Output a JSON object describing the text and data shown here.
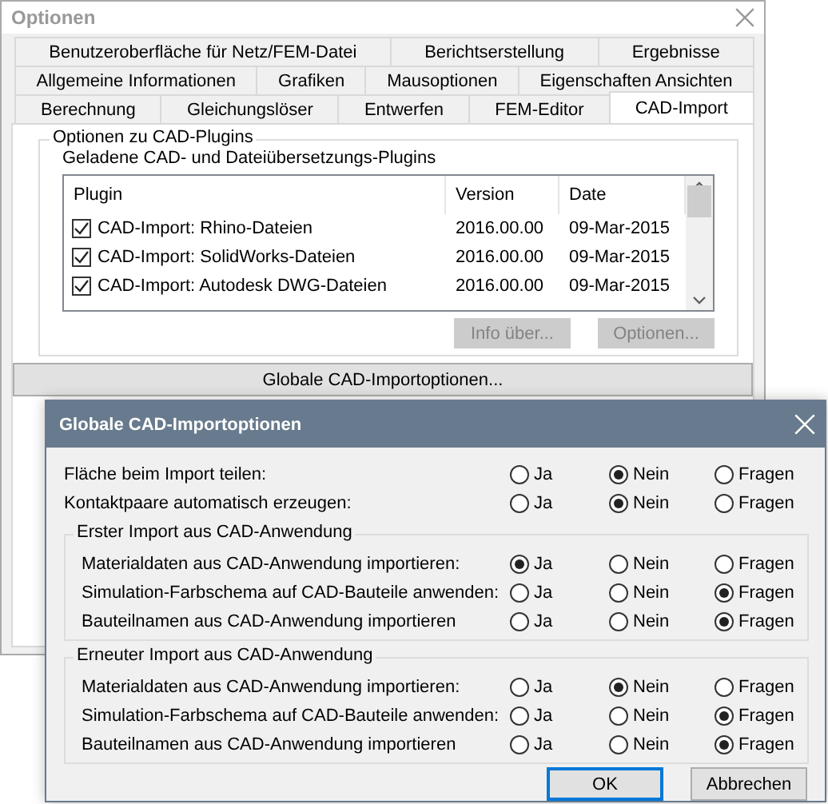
{
  "window": {
    "title": "Optionen"
  },
  "tab_rows": [
    [
      {
        "label": "Benutzeroberfläche für Netz/FEM-Datei",
        "selected": false
      },
      {
        "label": "Berichtserstellung",
        "selected": false
      },
      {
        "label": "Ergebnisse",
        "selected": false
      }
    ],
    [
      {
        "label": "Allgemeine Informationen",
        "selected": false
      },
      {
        "label": "Grafiken",
        "selected": false
      },
      {
        "label": "Mausoptionen",
        "selected": false
      },
      {
        "label": "Eigenschaften Ansichten",
        "selected": false
      }
    ],
    [
      {
        "label": "Berechnung",
        "selected": false
      },
      {
        "label": "Gleichungslöser",
        "selected": false
      },
      {
        "label": "Entwerfen",
        "selected": false
      },
      {
        "label": "FEM-Editor",
        "selected": false
      },
      {
        "label": "CAD-Import",
        "selected": true
      }
    ]
  ],
  "plugins_group": {
    "title": "Optionen zu CAD-Plugins",
    "subtitle": "Geladene CAD- und Dateiübersetzungs-Plugins",
    "columns": [
      "Plugin",
      "Version",
      "Date"
    ],
    "rows": [
      {
        "checked": true,
        "plugin": "CAD-Import:  Rhino-Dateien",
        "version": "2016.00.00",
        "date": "09-Mar-2015"
      },
      {
        "checked": true,
        "plugin": "CAD-Import:  SolidWorks-Dateien",
        "version": "2016.00.00",
        "date": "09-Mar-2015"
      },
      {
        "checked": true,
        "plugin": "CAD-Import: Autodesk DWG-Dateien",
        "version": "2016.00.00",
        "date": "09-Mar-2015"
      }
    ],
    "buttons": [
      {
        "label": "Info über...",
        "disabled": true
      },
      {
        "label": "Optionen...",
        "disabled": true
      }
    ]
  },
  "global_button": {
    "label": "Globale CAD-Importoptionen..."
  },
  "dialog": {
    "title": "Globale CAD-Importoptionen",
    "options": [
      {
        "label": "Fläche beim Import teilen:",
        "choices": [
          {
            "label": "Ja",
            "selected": false
          },
          {
            "label": "Nein",
            "selected": true
          },
          {
            "label": "Fragen",
            "selected": false
          }
        ]
      },
      {
        "label": "Kontaktpaare automatisch erzeugen:",
        "choices": [
          {
            "label": "Ja",
            "selected": false
          },
          {
            "label": "Nein",
            "selected": true
          },
          {
            "label": "Fragen",
            "selected": false
          }
        ]
      }
    ],
    "groups": [
      {
        "title": "Erster Import aus CAD-Anwendung",
        "options": [
          {
            "label": "Materialdaten aus CAD-Anwendung importieren:",
            "choices": [
              {
                "label": "Ja",
                "selected": true
              },
              {
                "label": "Nein",
                "selected": false
              },
              {
                "label": "Fragen",
                "selected": false
              }
            ]
          },
          {
            "label": "Simulation-Farbschema auf CAD-Bauteile anwenden:",
            "choices": [
              {
                "label": "Ja",
                "selected": false
              },
              {
                "label": "Nein",
                "selected": false
              },
              {
                "label": "Fragen",
                "selected": true
              }
            ]
          },
          {
            "label": "Bauteilnamen aus CAD-Anwendung importieren",
            "choices": [
              {
                "label": "Ja",
                "selected": false
              },
              {
                "label": "Nein",
                "selected": false
              },
              {
                "label": "Fragen",
                "selected": true
              }
            ]
          }
        ]
      },
      {
        "title": "Erneuter Import aus CAD-Anwendung",
        "options": [
          {
            "label": "Materialdaten aus CAD-Anwendung importieren:",
            "choices": [
              {
                "label": "Ja",
                "selected": false
              },
              {
                "label": "Nein",
                "selected": true
              },
              {
                "label": "Fragen",
                "selected": false
              }
            ]
          },
          {
            "label": "Simulation-Farbschema auf CAD-Bauteile anwenden:",
            "choices": [
              {
                "label": "Ja",
                "selected": false
              },
              {
                "label": "Nein",
                "selected": false
              },
              {
                "label": "Fragen",
                "selected": true
              }
            ]
          },
          {
            "label": "Bauteilnamen aus CAD-Anwendung importieren",
            "choices": [
              {
                "label": "Ja",
                "selected": false
              },
              {
                "label": "Nein",
                "selected": false
              },
              {
                "label": "Fragen",
                "selected": true
              }
            ]
          }
        ]
      }
    ],
    "buttons": [
      {
        "label": "OK",
        "focused": true
      },
      {
        "label": "Abbrechen",
        "focused": false
      }
    ]
  }
}
